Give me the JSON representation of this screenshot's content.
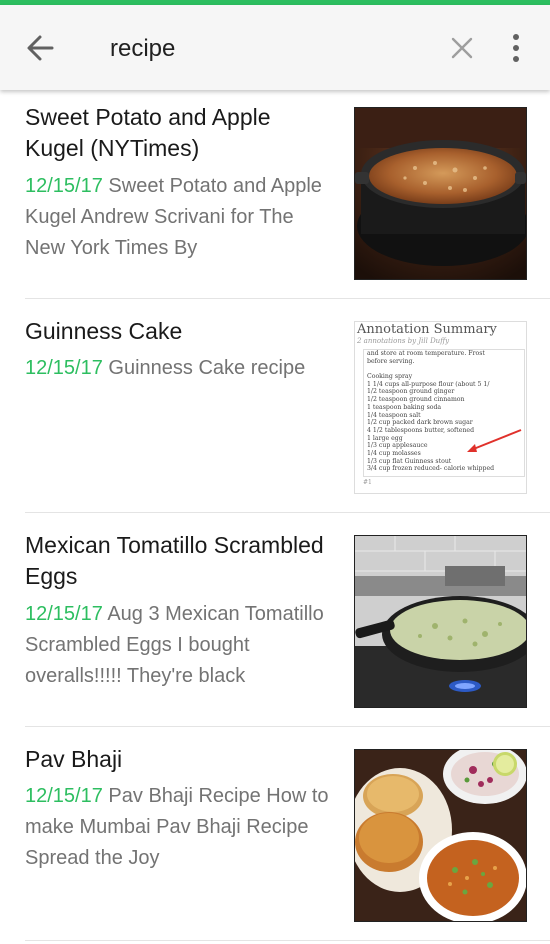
{
  "search": {
    "query": "recipe",
    "placeholder": ""
  },
  "icons": {
    "back": "arrow-back-icon",
    "clear": "close-icon",
    "more": "more-vert-icon"
  },
  "colors": {
    "accent": "#2DBE60",
    "title": "#1a1a1a",
    "snippet": "#737373"
  },
  "notes": [
    {
      "title": "Sweet Potato and Apple Kugel (NYTimes)",
      "date": "12/15/17",
      "snippet": "Sweet Potato and Apple Kugel Andrew Scrivani for The New York Times By",
      "thumbnail": "pot-of-kugel-photo"
    },
    {
      "title": "Guinness Cake",
      "date": "12/15/17",
      "snippet": "Guinness Cake recipe",
      "thumbnail": "annotation-summary-document",
      "thumb_text": {
        "heading": "Annotation Summary",
        "sub": "2 annotations by Jill Duffy",
        "lines": [
          "and store at room temperature. Frost",
          "before serving.",
          "",
          "Cooking spray",
          "1 1/4 cups all-purpose flour (about 5 1/",
          "1/2 teaspoon ground ginger",
          "1/2 teaspoon ground cinnamon",
          "1 teaspoon baking soda",
          "1/4 teaspoon salt",
          "1/2 cup packed dark brown sugar",
          "4 1/2 tablespoons butter, softened",
          "1 large egg",
          "1/3 cup applesauce",
          "1/4 cup molasses",
          "1/3 cup flat Guinness stout",
          "3/4 cup frozen reduced- calorie whipped"
        ],
        "footer": "#1"
      }
    },
    {
      "title": "Mexican Tomatillo Scrambled Eggs",
      "date": "12/15/17",
      "snippet": "Aug 3 Mexican Tomatillo Scrambled Eggs I bought overalls!!!!! They're black",
      "thumbnail": "skillet-eggs-photo"
    },
    {
      "title": "Pav Bhaji",
      "date": "12/15/17",
      "snippet": "Pav Bhaji Recipe How to make Mumbai Pav Bhaji Recipe Spread the Joy",
      "thumbnail": "pav-bhaji-photo"
    }
  ]
}
